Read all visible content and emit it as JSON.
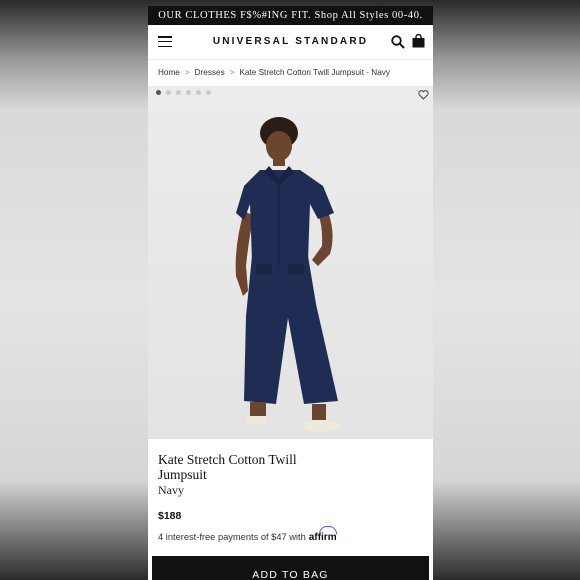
{
  "promo_banner": "OUR CLOTHES F$%#ING FIT. Shop All Styles 00-40.",
  "header": {
    "brand": "UNIVERSAL STANDARD",
    "icons": [
      "menu-icon",
      "search-icon",
      "bag-icon"
    ]
  },
  "breadcrumb": {
    "items": [
      "Home",
      "Dresses",
      "Kate Stretch Cotton Twill Jumpsuit - Navy"
    ],
    "separator": ">"
  },
  "gallery": {
    "dot_count": 6,
    "active_index": 0,
    "icons": [
      "heart-icon"
    ]
  },
  "product": {
    "title": "Kate Stretch Cotton Twill Jumpsuit",
    "color": "Navy",
    "price": "$188",
    "installments": "4 interest-free payments of $47 with",
    "installments_provider": "affirm"
  },
  "add_to_bag_label": "ADD TO BAG",
  "colors": {
    "accent": "#111111",
    "garment": "#1f2d54",
    "affirm": "#3d5afe"
  }
}
